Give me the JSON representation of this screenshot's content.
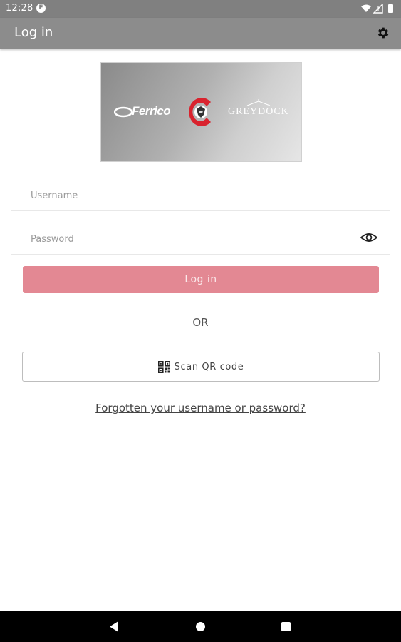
{
  "status_bar": {
    "time": "12:28",
    "notification_icon": "F"
  },
  "app_bar": {
    "title": "Log in",
    "settings_icon": "gear-icon"
  },
  "logo": {
    "brand_left": "Ferrico",
    "brand_right": "GREYDOCK"
  },
  "username": {
    "placeholder": "Username",
    "value": ""
  },
  "password": {
    "placeholder": "Password",
    "value": "",
    "toggle_icon": "eye-icon"
  },
  "login_button": {
    "label": "Log in",
    "color": "#e38893"
  },
  "divider_text": "OR",
  "qr_button": {
    "label": "Scan QR code",
    "icon": "qr-code-icon"
  },
  "forgot_link": "Forgotten your username or password?",
  "nav_bar": {
    "back_icon": "back-icon",
    "home_icon": "home-icon",
    "recents_icon": "recents-icon"
  }
}
